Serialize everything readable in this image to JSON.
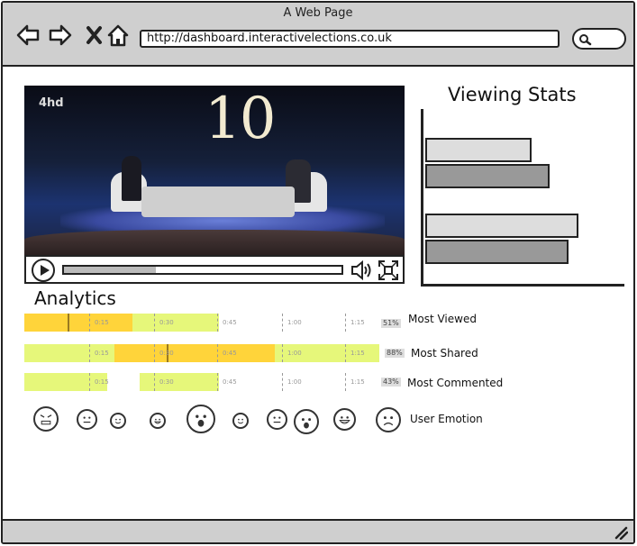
{
  "browser": {
    "title": "A Web Page",
    "url": "http://dashboard.interactivelections.co.uk",
    "nav_icons": [
      "back-icon",
      "forward-icon",
      "close-icon",
      "home-icon"
    ],
    "search_icon": "search-icon"
  },
  "video": {
    "overlay_number": "10",
    "channel_logo": "4hd",
    "progress_fraction": 0.33,
    "controls": [
      "play-icon",
      "volume-icon",
      "fullscreen-icon"
    ]
  },
  "viewing_stats": {
    "title": "Viewing Stats",
    "chart_data": {
      "type": "bar",
      "orientation": "horizontal",
      "bars": [
        {
          "group": 1,
          "shade": "light",
          "relative_value": 0.55
        },
        {
          "group": 1,
          "shade": "dark",
          "relative_value": 0.64
        },
        {
          "group": 2,
          "shade": "light",
          "relative_value": 0.79
        },
        {
          "group": 2,
          "shade": "dark",
          "relative_value": 0.74
        }
      ],
      "colors": {
        "light": "#dddddd",
        "dark": "#999999"
      },
      "grid": false
    }
  },
  "analytics": {
    "title": "Analytics",
    "colors": {
      "low": "#e6f77a",
      "high": "#ffd43a"
    },
    "rows": [
      {
        "label": "Most Viewed",
        "percent": "51%",
        "ticks": [
          "0:15",
          "0:30",
          "0:45",
          "1:00",
          "1:15"
        ]
      },
      {
        "label": "Most Shared",
        "percent": "88%",
        "ticks": [
          "0:15",
          "0:30",
          "0:45",
          "1:00",
          "1:15"
        ]
      },
      {
        "label": "Most Commented",
        "percent": "43%",
        "ticks": [
          "0:15",
          "0:30",
          "0:45",
          "1:00",
          "1:15"
        ]
      }
    ]
  },
  "user_emotion": {
    "label": "User Emotion",
    "faces": [
      "angry",
      "neutral",
      "smile",
      "grin",
      "surprised",
      "smile",
      "neutral",
      "surprised",
      "laugh",
      "sad"
    ]
  }
}
